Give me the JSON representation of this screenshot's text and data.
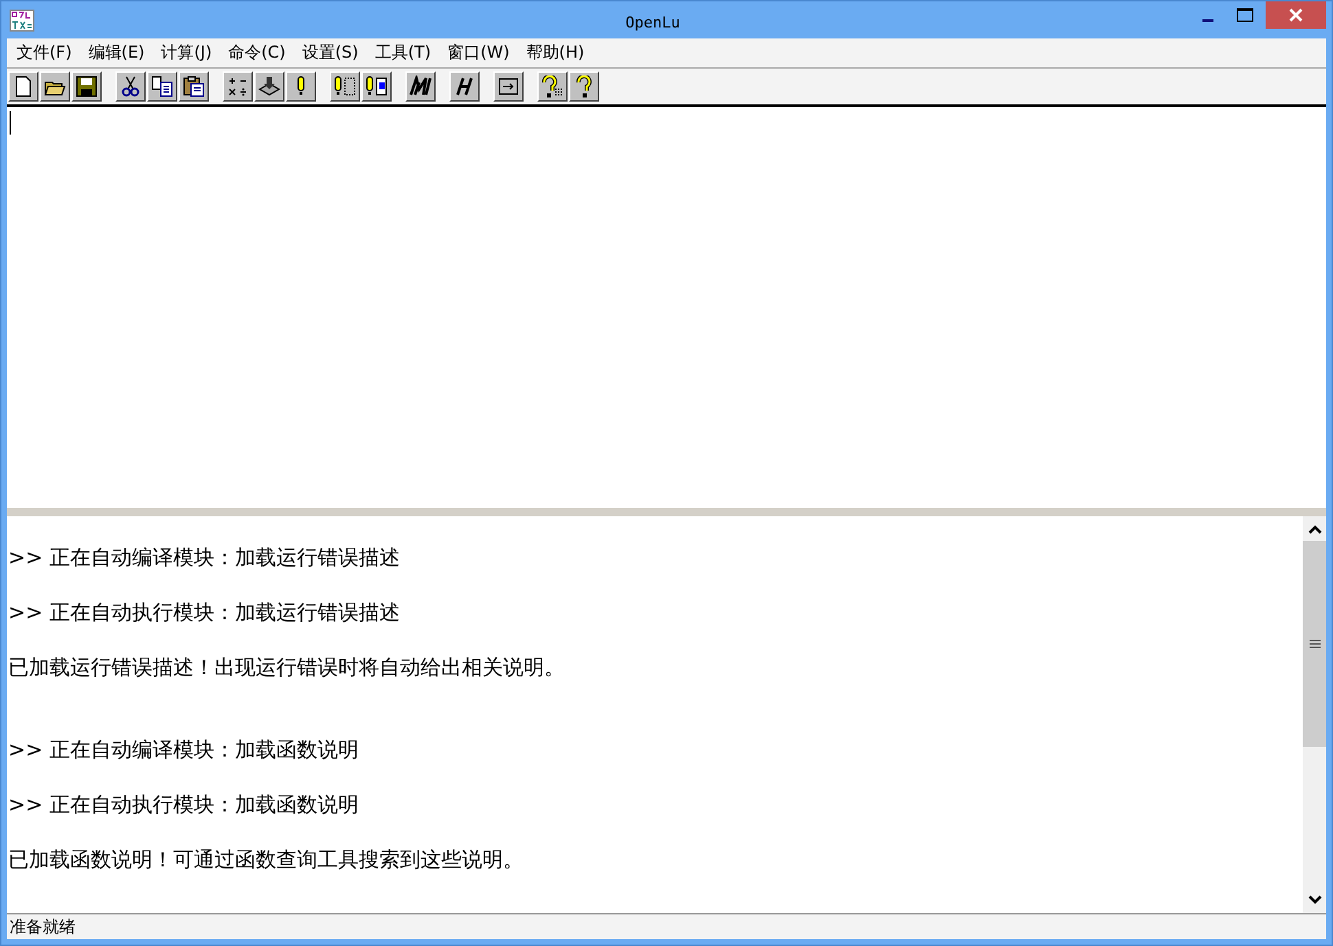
{
  "window": {
    "title": "OpenLu"
  },
  "menu": [
    {
      "label": "文件(F)"
    },
    {
      "label": "编辑(E)"
    },
    {
      "label": "计算(J)"
    },
    {
      "label": "命令(C)"
    },
    {
      "label": "设置(S)"
    },
    {
      "label": "工具(T)"
    },
    {
      "label": "窗口(W)"
    },
    {
      "label": "帮助(H)"
    }
  ],
  "output": {
    "groups": [
      [
        ">> 正在自动编译模块：加载运行错误描述",
        ">> 正在自动执行模块：加载运行错误描述",
        "已加载运行错误描述！出现运行错误时将自动给出相关说明。"
      ],
      [
        ">> 正在自动编译模块：加载函数说明",
        ">> 正在自动执行模块：加载函数说明",
        "已加载函数说明！可通过函数查询工具搜索到这些说明。"
      ]
    ]
  },
  "status_bar": {
    "text": "准备就绪"
  }
}
